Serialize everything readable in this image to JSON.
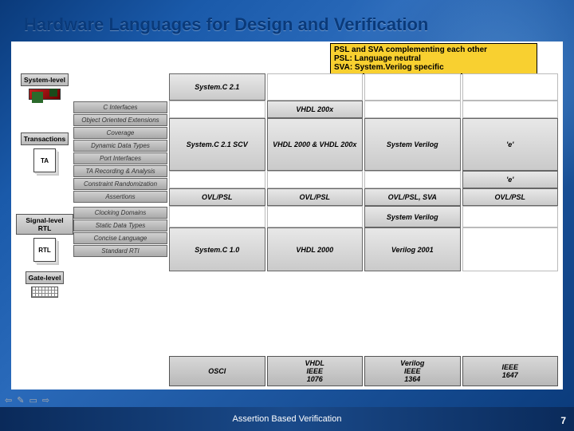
{
  "title": "Hardware Languages for Design and Verification",
  "footer": "Assertion Based Verification",
  "page_number": "7",
  "callout": {
    "line1": "PSL and SVA complementing each other",
    "line2": "PSL: Language neutral",
    "line3": "SVA: System.Verilog specific"
  },
  "levels": {
    "l0": "System-level",
    "l1": "Transactions",
    "l2": "Signal-level RTL",
    "l3": "Gate-level"
  },
  "doc_labels": {
    "ta": "TA",
    "rtl": "RTL"
  },
  "features_system": [
    "System.C 2.1"
  ],
  "features_trans": [
    "C Interfaces",
    "Object Oriented Extensions",
    "Coverage",
    "Dynamic Data Types",
    "Port Interfaces",
    "TA Recording & Analysis",
    "Constraint Randomization",
    "Assertions"
  ],
  "features_rtl": [
    "Clocking Domains",
    "Static Data Types",
    "Concise Language",
    "Standard RTI"
  ],
  "langs": {
    "system_row": [
      "System.C 2.1",
      "",
      "",
      ""
    ],
    "mid_row1": [
      "",
      "VHDL 200x",
      "",
      ""
    ],
    "mid_row2": [
      "System.C 2.1 SCV",
      "VHDL 2000 & VHDL 200x",
      "System Verilog",
      "'e'"
    ],
    "e_row": [
      "",
      "",
      "",
      "'e'"
    ],
    "assert_row": [
      "OVL/PSL",
      "OVL/PSL",
      "OVL/PSL, SVA",
      "OVL/PSL"
    ],
    "rtl_row1": [
      "",
      "",
      "System Verilog",
      ""
    ],
    "rtl_row2": [
      "System.C 1.0",
      "VHDL 2000",
      "Verilog 2001",
      ""
    ]
  },
  "standards": [
    "OSCI",
    "VHDL\nIEEE\n1076",
    "Verilog\nIEEE\n1364",
    "IEEE\n1647"
  ]
}
